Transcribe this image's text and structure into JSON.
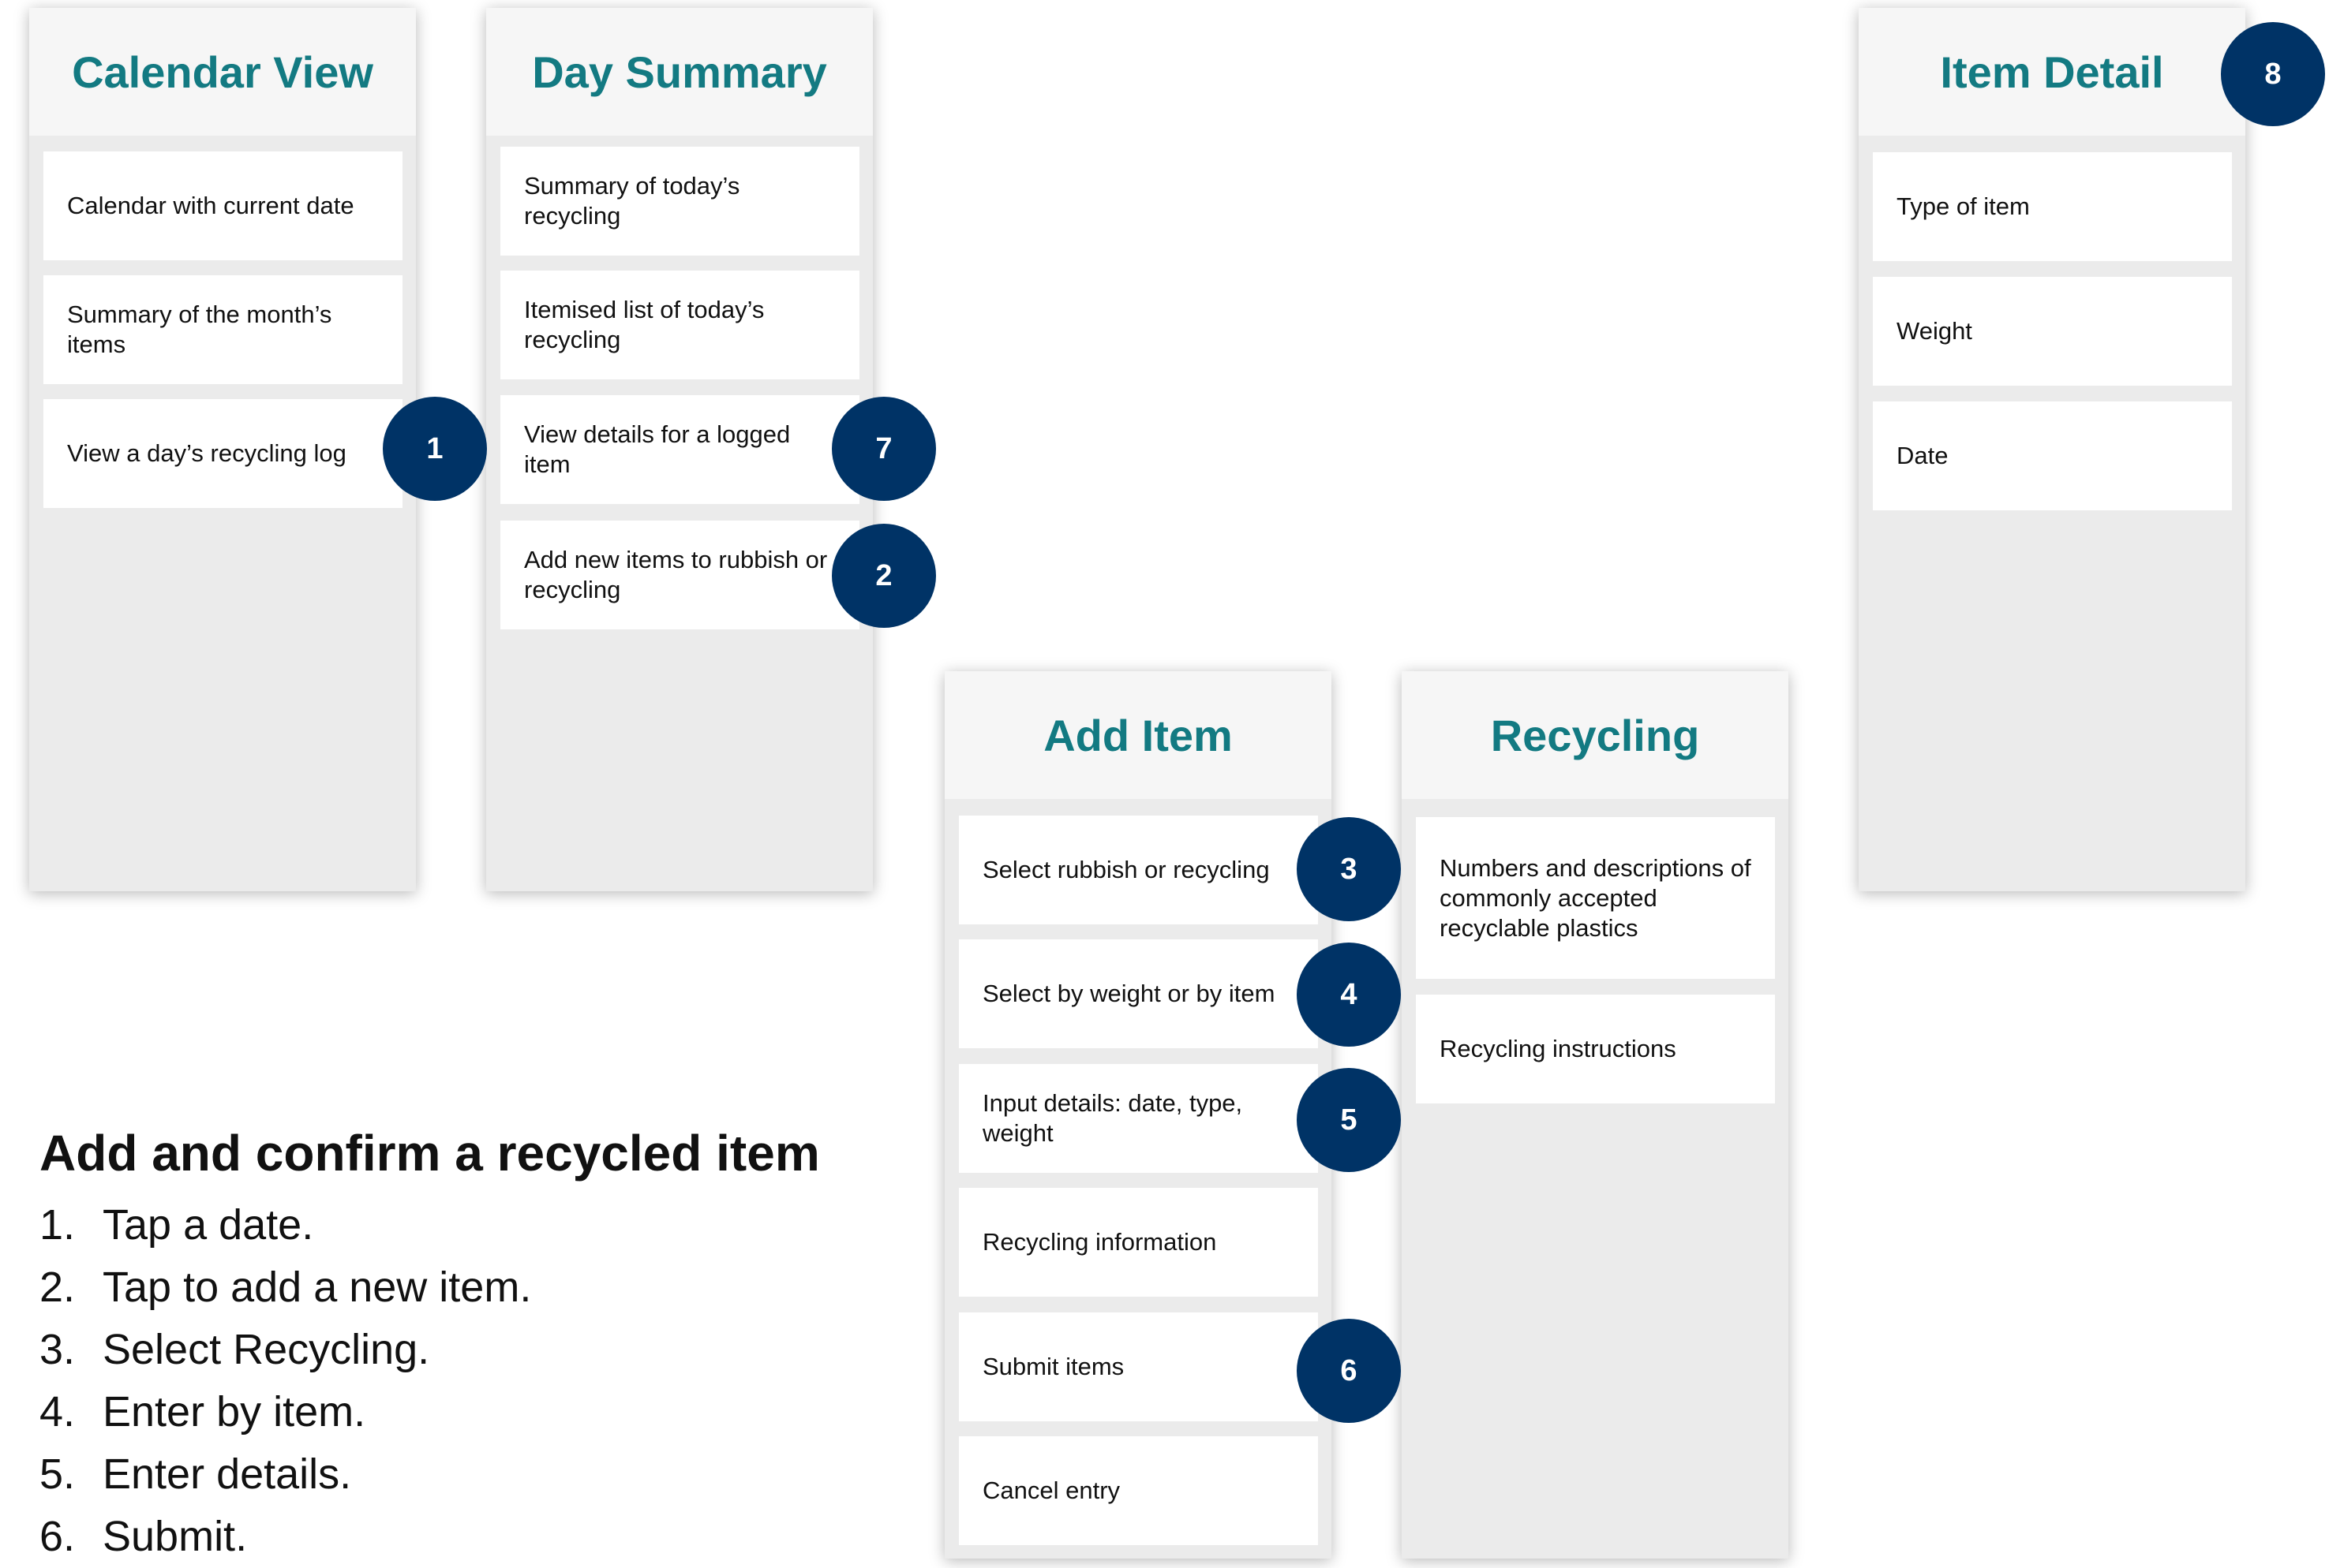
{
  "columns": [
    {
      "title": "Calendar View",
      "cards": [
        "Calendar with current date",
        "Summary of the month’s items",
        "View a day’s recycling log"
      ]
    },
    {
      "title": "Day Summary",
      "cards": [
        "Summary of today’s recycling",
        "Itemised list of today’s recycling",
        "View details for a logged item",
        "Add new items to rubbish or recycling"
      ]
    },
    {
      "title": "Add Item",
      "cards": [
        "Select rubbish or recycling",
        "Select by weight or by item",
        "Input details: date, type, weight",
        "Recycling information",
        "Submit items",
        "Cancel entry"
      ]
    },
    {
      "title": "Recycling",
      "cards": [
        "Numbers and descriptions of commonly accepted recyclable plastics",
        "Recycling instructions"
      ]
    },
    {
      "title": "Item Detail",
      "cards": [
        "Type of item",
        "Weight",
        "Date"
      ]
    }
  ],
  "badges": [
    "1",
    "7",
    "2",
    "3",
    "4",
    "5",
    "6",
    "8"
  ],
  "steps": {
    "title": "Add and confirm a recycled item",
    "items": [
      {
        "num": "1.",
        "text": "Tap a date."
      },
      {
        "num": "2.",
        "text": "Tap to add a new item."
      },
      {
        "num": "3.",
        "text": "Select Recycling."
      },
      {
        "num": "4.",
        "text": "Enter by item."
      },
      {
        "num": "5.",
        "text": "Enter details."
      },
      {
        "num": "6.",
        "text": "Submit."
      }
    ]
  },
  "colors": {
    "header_text": "#137a82",
    "badge_fill": "#003366",
    "column_bg": "#ebebeb",
    "header_bg": "#f6f6f6"
  }
}
